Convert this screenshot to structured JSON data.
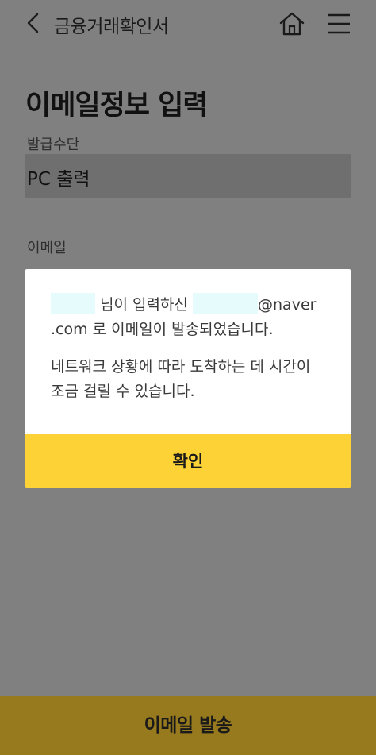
{
  "header": {
    "title": "금융거래확인서",
    "back_icon": "chevron-left-icon",
    "home_icon": "home-icon",
    "menu_icon": "hamburger-menu-icon"
  },
  "page": {
    "title": "이메일정보 입력",
    "issue_method_label": "발급수단",
    "issue_method_value": "PC 출력",
    "email_label": "이메일"
  },
  "dialog": {
    "line1_mid": "님이 입력하신",
    "line1_end": "@naver",
    "line2": ".com 로 이메일이 발송되었습니다.",
    "para2_line1": "네트워크 상황에 따라 도착하는 데 시간이",
    "para2_line2": "조금 걸릴  수 있습니다.",
    "confirm_label": "확인"
  },
  "footer": {
    "send_label": "이메일 발송"
  },
  "colors": {
    "overlay_bg": "#808080",
    "confirm_button": "#fdd236",
    "send_button_dimmed": "#977a1e",
    "redaction": "#e6fbfb"
  }
}
